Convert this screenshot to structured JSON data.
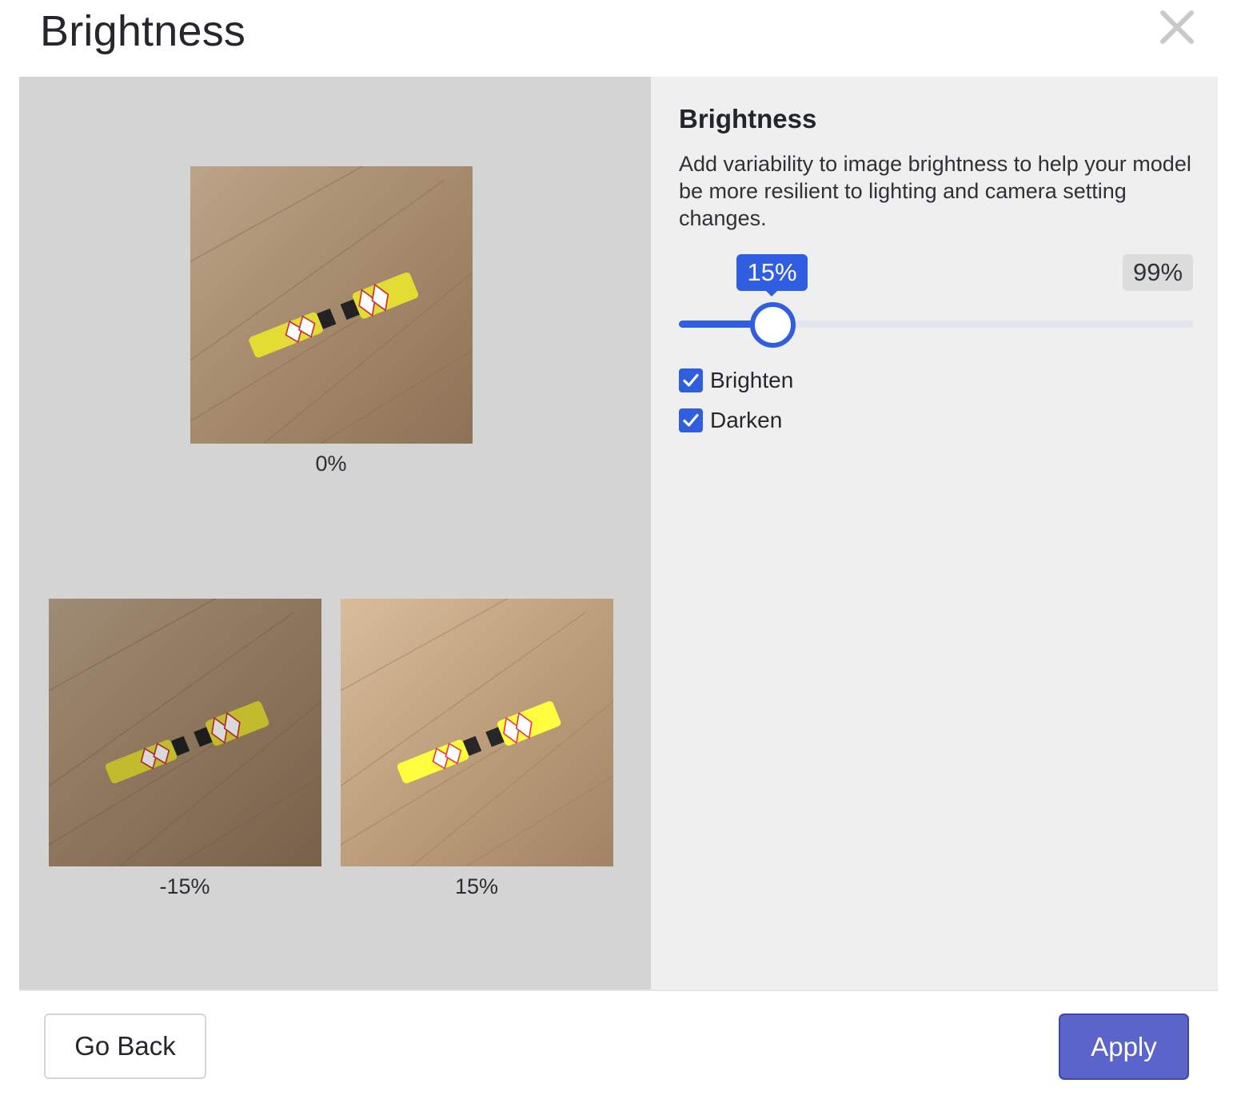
{
  "dialog": {
    "title": "Brightness"
  },
  "preview": {
    "images": [
      {
        "label": "0%",
        "brightness": 0
      },
      {
        "label": "-15%",
        "brightness": -15
      },
      {
        "label": "15%",
        "brightness": 15
      }
    ]
  },
  "settings": {
    "heading": "Brightness",
    "description": "Add variability to image brightness to help your model be more resilient to lighting and camera setting changes.",
    "slider": {
      "value_label": "15%",
      "max_label": "99%",
      "value": 15,
      "max": 99
    },
    "options": [
      {
        "label": "Brighten",
        "checked": true
      },
      {
        "label": "Darken",
        "checked": true
      }
    ]
  },
  "footer": {
    "back_label": "Go Back",
    "apply_label": "Apply"
  },
  "colors": {
    "accent": "#2f5fe0",
    "apply": "#5b64c8",
    "preview_bg": "#d4d4d4",
    "settings_bg": "#efefef"
  }
}
